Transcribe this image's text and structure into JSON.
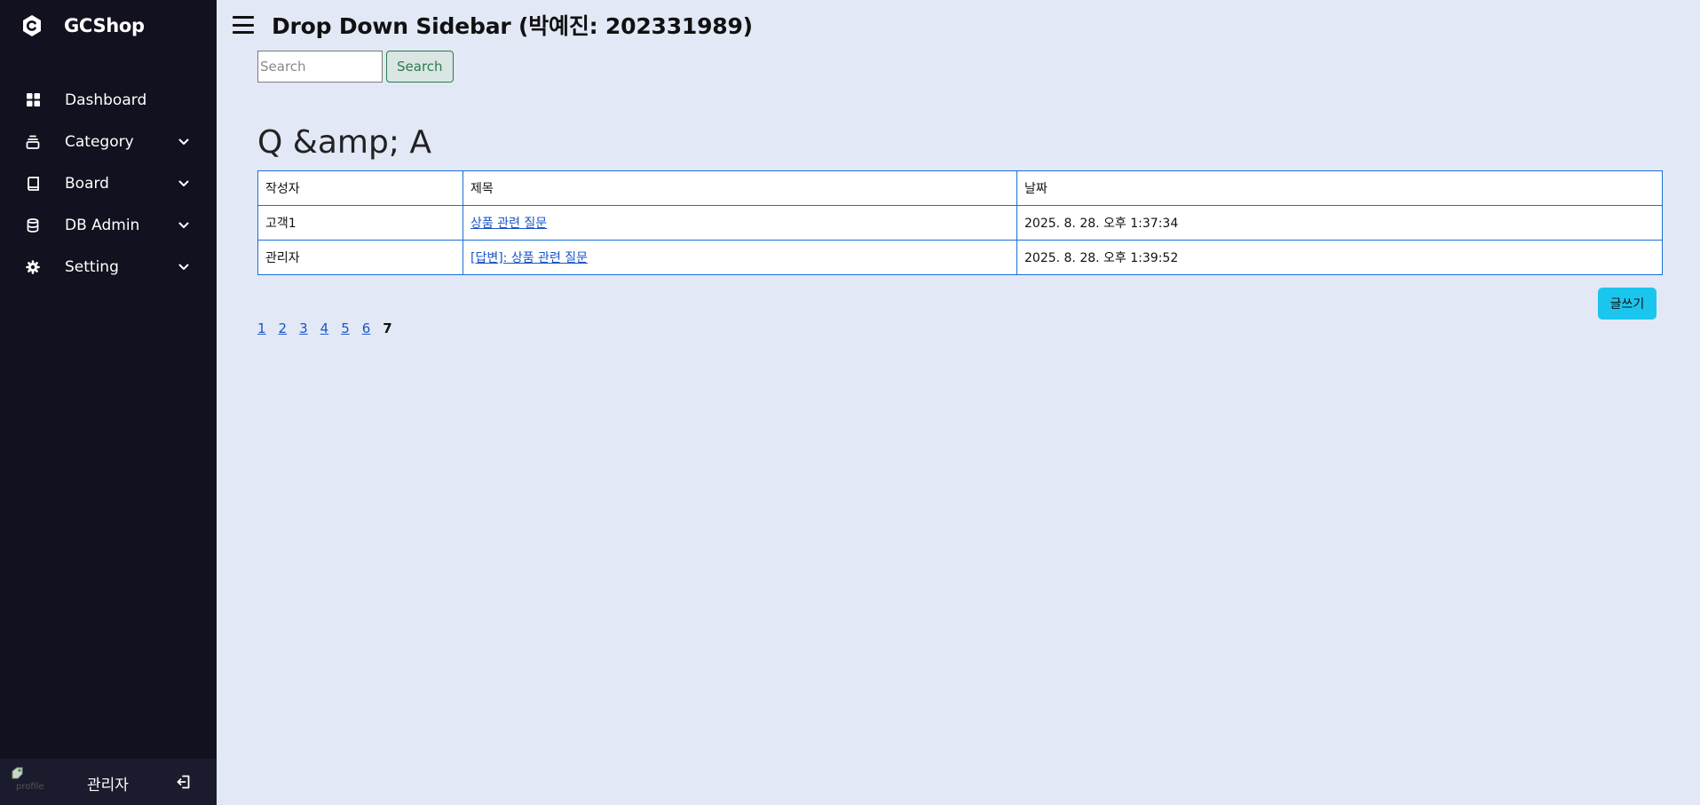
{
  "brand": {
    "name": "GCShop",
    "logo_icon": "c-hexagon-icon"
  },
  "sidebar": {
    "items": [
      {
        "label": "Dashboard",
        "icon": "grid-icon",
        "has_dropdown": false
      },
      {
        "label": "Category",
        "icon": "layers-icon",
        "has_dropdown": true
      },
      {
        "label": "Board",
        "icon": "book-icon",
        "has_dropdown": true
      },
      {
        "label": "DB Admin",
        "icon": "database-icon",
        "has_dropdown": true
      },
      {
        "label": "Setting",
        "icon": "gear-icon",
        "has_dropdown": true
      }
    ],
    "footer": {
      "user_name": "관리자",
      "avatar_alt": "profile"
    }
  },
  "header": {
    "title": "Drop Down Sidebar (박예진: 202331989)"
  },
  "search": {
    "placeholder": "Search",
    "button_label": "Search"
  },
  "main": {
    "section_title": "Q &amp; A",
    "table": {
      "headers": [
        "작성자",
        "제목",
        "날짜"
      ],
      "rows": [
        {
          "author": "고객1",
          "title": "상품 관련 질문",
          "date": "2025. 8. 28. 오후 1:37:34"
        },
        {
          "author": "관리자",
          "title": "[답변]: 상품 관련 질문",
          "date": "2025. 8. 28. 오후 1:39:52"
        }
      ]
    },
    "write_button_label": "글쓰기",
    "pagination": {
      "pages": [
        "1",
        "2",
        "3",
        "4",
        "5",
        "6",
        "7"
      ],
      "current": "7"
    }
  },
  "colors": {
    "sidebar_bg": "#11111f",
    "page_bg": "#e2e8f6",
    "table_border": "#1a6fd8",
    "write_button": "#1bc6ee",
    "search_button": "#2b7a4b"
  }
}
